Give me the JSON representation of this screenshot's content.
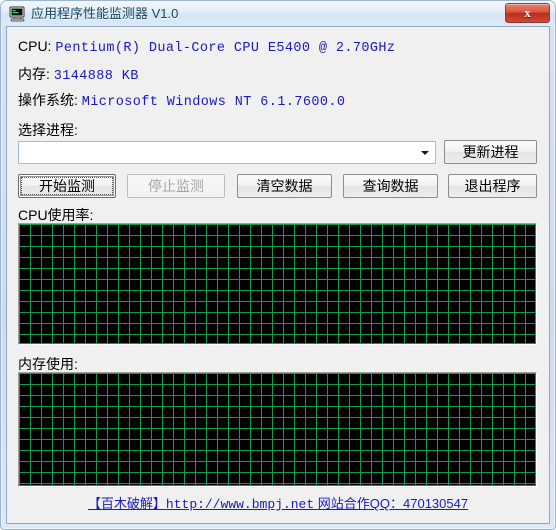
{
  "window": {
    "title": "应用程序性能监测器 V1.0",
    "icon": "monitor-icon",
    "close_label": "x",
    "accent_color": "#1a1ac0",
    "grid_color": "#0c9c4d",
    "grid_background": "#000000",
    "client_background": "#f0f0f0"
  },
  "info": {
    "cpu_label": "CPU:",
    "cpu_value": "Pentium(R) Dual-Core  CPU      E5400  @ 2.70GHz",
    "mem_label": "内存:",
    "mem_value": "3144888 KB",
    "os_label": "操作系统:",
    "os_value": "Microsoft Windows NT 6.1.7600.0"
  },
  "process": {
    "label": "选择进程:",
    "selected": "",
    "placeholder": "",
    "dropdown_icon": "chevron-down-icon",
    "refresh_label": "更新进程"
  },
  "actions": {
    "start_label": "开始监测",
    "start_focused": true,
    "start_enabled": true,
    "stop_label": "停止监测",
    "stop_enabled": false,
    "clear_label": "清空数据",
    "query_label": "查询数据",
    "exit_label": "退出程序"
  },
  "graphs": {
    "cpu_label": "CPU使用率:",
    "mem_label": "内存使用:",
    "cpu_series": [],
    "mem_series": []
  },
  "footer": {
    "site_cn": "【百木破解】",
    "url": "http://www.bmpj.net",
    "spacer": "  ",
    "qq_label": "网站合作QQ：470130547"
  }
}
